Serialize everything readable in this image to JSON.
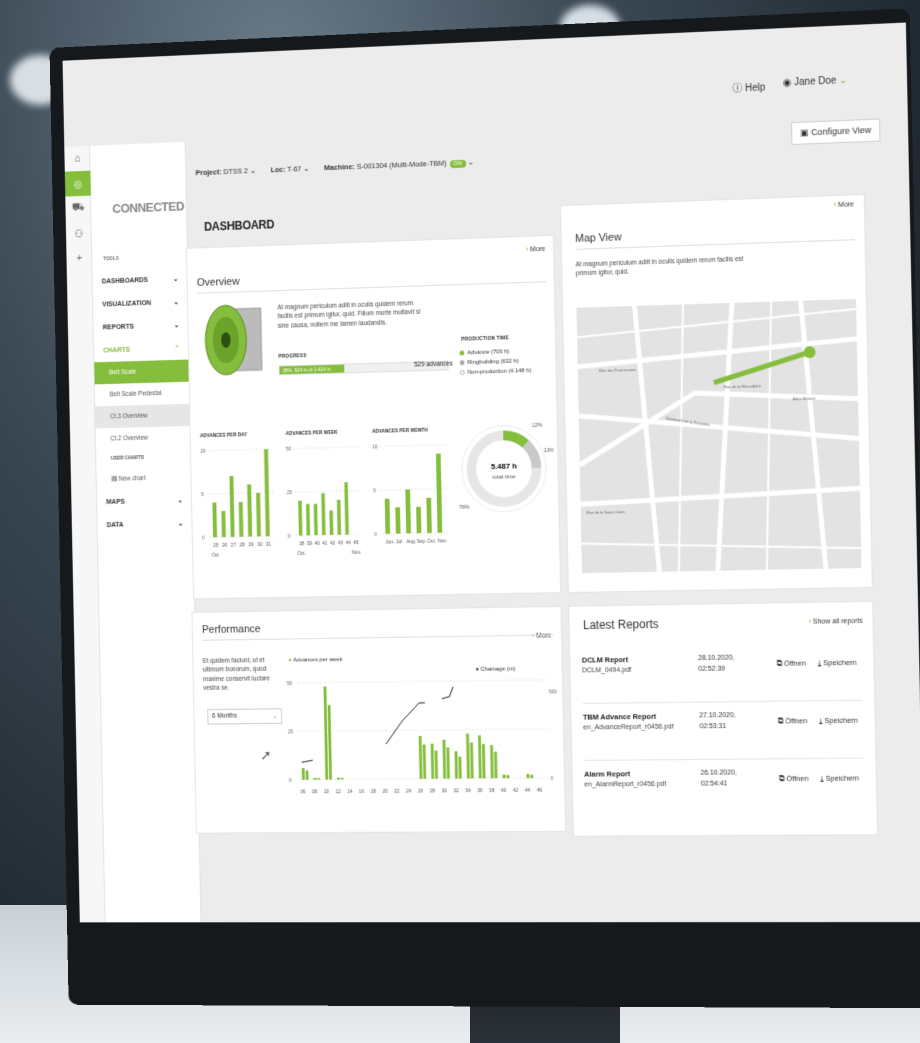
{
  "header": {
    "help_label": "Help",
    "user_name": "Jane Doe",
    "configure_label": "Configure View",
    "project_label": "Project:",
    "project_value": "DTSS 2",
    "loc_label": "Loc:",
    "loc_value": "T-67",
    "machine_label": "Machine:",
    "machine_value": "S-001304 (Multi-Mode-TBM)",
    "machine_badge": "ON"
  },
  "sidebar": {
    "logo_text": "CONNECTED",
    "tools_label": "TOOLS",
    "items": [
      {
        "label": "DASHBOARDS"
      },
      {
        "label": "VISUALIZATION"
      },
      {
        "label": "REPORTS"
      },
      {
        "label": "CHARTS"
      },
      {
        "label": "MAPS"
      },
      {
        "label": "DATA"
      }
    ],
    "charts_sub": [
      "Belt Scale",
      "Belt Scale Pedestal",
      "Ct.3 Overview",
      "Ct.2 Overview"
    ],
    "user_charts_label": "USER CHARTS",
    "new_chart_label": "New chart"
  },
  "page_title": "DASHBOARD",
  "overview": {
    "more": "More",
    "title": "Overview",
    "text": "At magnum periculum adiit in oculis quidem rerum facilis est primum igitur, quid. Filium morte multavit si sine causa, nollem me tamen laudandis.",
    "progress_label": "PROGRESS",
    "progress_fraction": 0.39,
    "progress_text": "38%, 924 m of 2.424 m",
    "advances_text": "529 advances",
    "production_label": "PRODUCTION TIME",
    "production_items": [
      "Advance (700 h)",
      "Ringbuilding (632 h)",
      "Non-production (4.148 h)"
    ],
    "donut_value": "5.487 h",
    "donut_sub": "total time",
    "donut_pcts": [
      "12%",
      "13%",
      "76%"
    ],
    "colors": {
      "green": "#85bd3c",
      "grey": "#c9c9c9"
    }
  },
  "chart_data": [
    {
      "type": "bar",
      "title": "ADVANCES PER DAY",
      "categories": [
        "25",
        "26",
        "27",
        "28",
        "29",
        "30",
        "31"
      ],
      "x_sublabel": "Oct.",
      "values": [
        4,
        3,
        7,
        4,
        6,
        5,
        14
      ],
      "ylim": [
        0,
        10
      ],
      "yticks": [
        "0",
        "5",
        "10"
      ]
    },
    {
      "type": "bar",
      "title": "ADVANCES PER WEEK",
      "categories": [
        "38",
        "39",
        "40",
        "41",
        "42",
        "43",
        "44",
        "45"
      ],
      "x_sublabel_left": "Oct.",
      "x_sublabel_right": "Nov.",
      "values": [
        20,
        18,
        18,
        24,
        14,
        20,
        30,
        0
      ],
      "ylim": [
        0,
        50
      ],
      "yticks": [
        "0",
        "25",
        "50"
      ]
    },
    {
      "type": "bar",
      "title": "ADVANCES PER MONTH",
      "categories": [
        "Jun.",
        "Jul.",
        "Aug.",
        "Sep.",
        "Oct.",
        "Nov."
      ],
      "values": [
        4,
        3,
        5,
        3,
        4,
        9
      ],
      "ylim": [
        0,
        10
      ],
      "yticks": [
        "0",
        "5",
        "10"
      ]
    },
    {
      "type": "bar",
      "title": "Performance",
      "series": [
        {
          "name": "Advances per week"
        },
        {
          "name": "Chainage (m)"
        }
      ],
      "categories": [
        "06",
        "08",
        "10",
        "12",
        "14",
        "16",
        "18",
        "20",
        "22",
        "24",
        "26",
        "28",
        "30",
        "32",
        "34",
        "36",
        "38",
        "40",
        "42",
        "44",
        "46"
      ],
      "values": [
        6,
        1,
        48,
        1,
        0,
        0,
        0,
        0,
        0,
        0,
        22,
        18,
        20,
        14,
        23,
        22,
        17,
        2,
        0,
        2,
        0
      ],
      "ylim": [
        0,
        50
      ],
      "yticks": [
        "0",
        "25",
        "50"
      ],
      "y2_ticks": [
        "0",
        "500"
      ]
    }
  ],
  "map": {
    "title": "Map View",
    "more": "More",
    "text": "At magnum periculum adiit in oculis quidem rerum facilis est primum igitur, quid.",
    "streets": [
      "Rue des Franciscains",
      "Boulevard de la Boissière",
      "Allée Bénouf",
      "Rue de la Renardière",
      "Rue de la Saone Loire"
    ]
  },
  "performance": {
    "title": "Performance",
    "more": "More",
    "text": "Et quidem faciunt, ut et ultimum bonorum, quod maxime conservit iuctare vestra se.",
    "select_value": "6 Months",
    "legend_left": "Advances per week",
    "legend_right": "Chainage (m)"
  },
  "reports": {
    "title": "Latest Reports",
    "show_all": "Show all reports",
    "open_label": "Öffnen",
    "save_label": "Speichern",
    "items": [
      {
        "name": "DCLM Report",
        "file": "DCLM_0494.pdf",
        "date": "28.10.2020,",
        "time": "02:52:39"
      },
      {
        "name": "TBM Advance Report",
        "file": "en_AdvanceReport_r0456.pdf",
        "date": "27.10.2020,",
        "time": "02:53:31"
      },
      {
        "name": "Alarm Report",
        "file": "en_AlarmReport_r0456.pdf",
        "date": "26.10.2020,",
        "time": "02:54:41"
      }
    ]
  }
}
